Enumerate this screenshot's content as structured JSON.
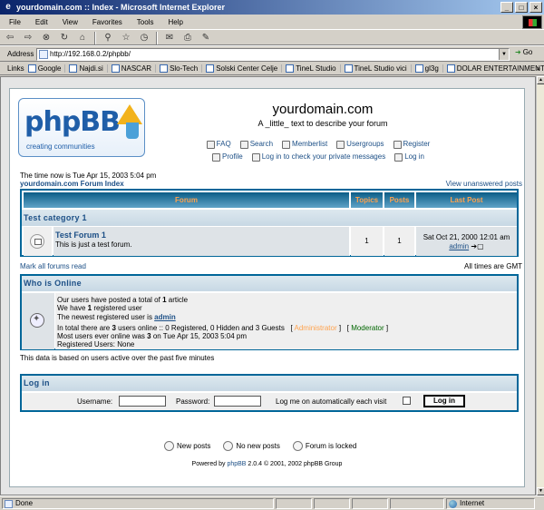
{
  "window": {
    "title": "yourdomain.com :: Index - Microsoft Internet Explorer"
  },
  "menu": [
    "File",
    "Edit",
    "View",
    "Favorites",
    "Tools",
    "Help"
  ],
  "address": {
    "label": "Address",
    "url": "http://192.168.0.2/phpbb/",
    "go": "Go"
  },
  "links": {
    "label": "Links",
    "items": [
      "Google",
      "Najdi.si",
      "NASCAR",
      "Slo-Tech",
      "Solski Center Celje",
      "TineL Studio",
      "TineL Studio vici",
      "gl3g",
      "DOLAR ENTERTAINMENT"
    ]
  },
  "header": {
    "logo_text": "phpBB",
    "logo_sub": "creating communities",
    "site_name": "yourdomain.com",
    "site_desc": "A _little_ text to describe your forum",
    "nav_row1": [
      "FAQ",
      "Search",
      "Memberlist",
      "Usergroups",
      "Register"
    ],
    "nav_row2": [
      "Profile",
      "Log in to check your private messages",
      "Log in"
    ]
  },
  "index": {
    "time_now": "The time now is Tue Apr 15, 2003 5:04 pm",
    "forum_index": "yourdomain.com Forum Index",
    "unanswered": "View unanswered posts",
    "columns": [
      "Forum",
      "Topics",
      "Posts",
      "Last Post"
    ],
    "category": "Test category 1",
    "forum": {
      "title": "Test Forum 1",
      "desc": "This is just a test forum.",
      "topics": "1",
      "posts": "1",
      "last_post_date": "Sat Oct 21, 2000 12:01 am",
      "last_post_author": "admin"
    },
    "mark_all": "Mark all forums read",
    "all_times": "All times are GMT"
  },
  "who": {
    "title": "Who is Online",
    "line1_a": "Our users have posted a total of ",
    "line1_b": "1",
    "line1_c": " article",
    "line2_a": "We have ",
    "line2_b": "1",
    "line2_c": " registered user",
    "line3_a": "The newest registered user is ",
    "line3_b": "admin",
    "line4_a": "In total there are ",
    "line4_b": "3",
    "line4_c": " users online :: 0 Registered, 0 Hidden and 3 Guests",
    "legend_admin": "Administrator",
    "legend_mod": "Moderator",
    "line5_a": "Most users ever online was ",
    "line5_b": "3",
    "line5_c": " on Tue Apr 15, 2003 5:04 pm",
    "line6": "Registered Users: None",
    "data_based": "This data is based on users active over the past five minutes"
  },
  "login": {
    "title": "Log in",
    "username_label": "Username:",
    "password_label": "Password:",
    "auto_label": "Log me on automatically each visit",
    "button": "Log in"
  },
  "legend": [
    "New posts",
    "No new posts",
    "Forum is locked"
  ],
  "footer": {
    "powered_a": "Powered by ",
    "powered_link": "phpBB",
    "powered_b": " 2.0.4 © 2001, 2002 phpBB Group"
  },
  "status": {
    "text": "Done",
    "zone": "Internet"
  }
}
